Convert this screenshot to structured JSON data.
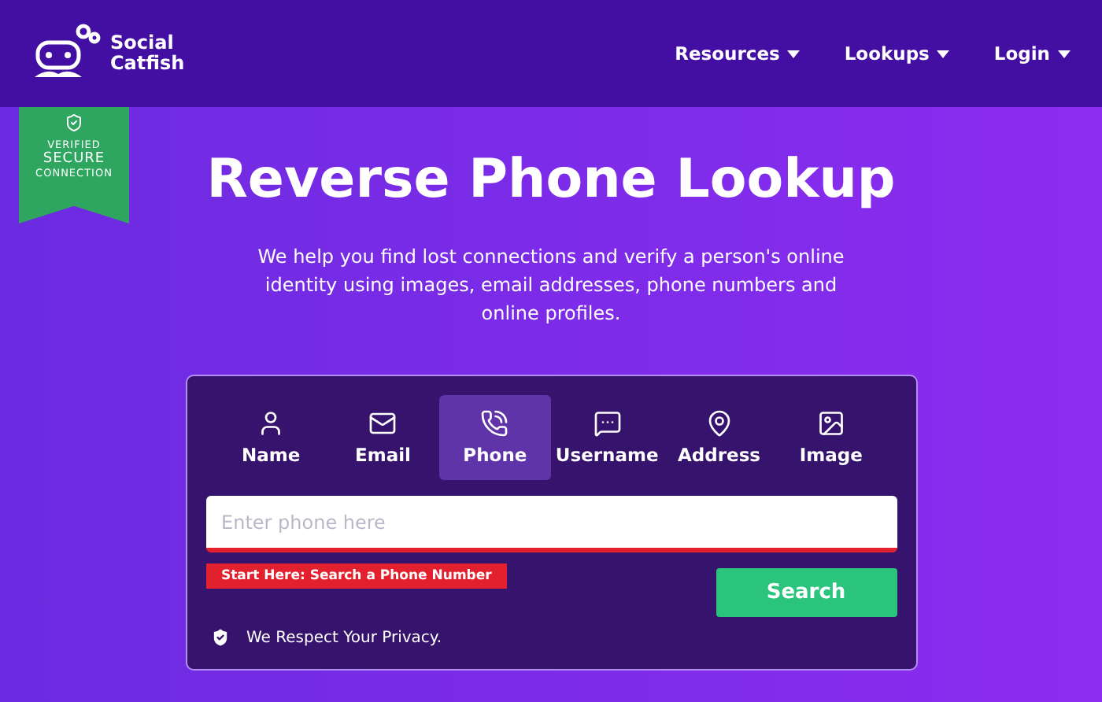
{
  "logo": {
    "line1": "Social",
    "line2": "Catfish"
  },
  "nav": [
    {
      "label": "Resources"
    },
    {
      "label": "Lookups"
    },
    {
      "label": "Login"
    }
  ],
  "badge": {
    "line1": "VERIFIED",
    "line2": "SECURE",
    "line3": "CONNECTION"
  },
  "title": "Reverse Phone Lookup",
  "intro": "We help you find lost connections and verify a person's online identity using images, email addresses, phone numbers and online profiles.",
  "tabs": [
    {
      "label": "Name",
      "kind": "person",
      "selected": false
    },
    {
      "label": "Email",
      "kind": "mail",
      "selected": false
    },
    {
      "label": "Phone",
      "kind": "phone",
      "selected": true
    },
    {
      "label": "Username",
      "kind": "chat",
      "selected": false
    },
    {
      "label": "Address",
      "kind": "pin",
      "selected": false
    },
    {
      "label": "Image",
      "kind": "image",
      "selected": false
    }
  ],
  "search": {
    "placeholder": "Enter phone here",
    "hint": "Start Here: Search a Phone Number",
    "button": "Search"
  },
  "privacy": "We Respect Your Privacy."
}
